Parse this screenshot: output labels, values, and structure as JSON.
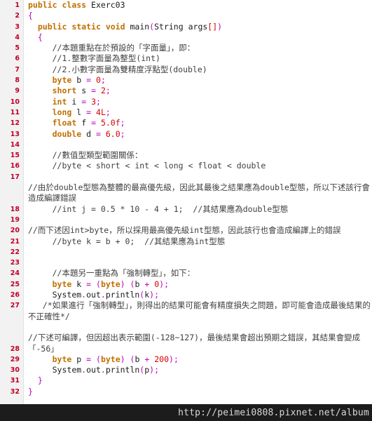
{
  "editor": {
    "language": "java",
    "class_name": "Exerc03",
    "colors": {
      "background": "#ffffff",
      "gutter_background": "#f2f2f2",
      "gutter_border": "#e2e2e2",
      "line_number": "#c00024",
      "keyword": "#c07000",
      "number_literal": "#d40000",
      "punctuation": "#c000c0",
      "comment": "#3f3f3f",
      "identifier": "#1a1a1a",
      "watermark_bar": "#1c1c1c",
      "watermark_text": "#d8d8d8"
    },
    "lines": [
      {
        "n": "1",
        "num_pos": "top",
        "text": "public class Exerc03"
      },
      {
        "n": "2",
        "num_pos": "top",
        "text": "{"
      },
      {
        "n": "3",
        "num_pos": "top",
        "text": "  public static void main(String args[])"
      },
      {
        "n": "4",
        "num_pos": "top",
        "text": "  {"
      },
      {
        "n": "5",
        "num_pos": "top",
        "text": "     //本題重點在於預設的「字面量」，即："
      },
      {
        "n": "6",
        "num_pos": "top",
        "text": "     //1.整數字面量為整型(int)"
      },
      {
        "n": "7",
        "num_pos": "top",
        "text": "     //2.小數字面量為雙精度浮點型(double)"
      },
      {
        "n": "8",
        "num_pos": "top",
        "text": "     byte b = 0;"
      },
      {
        "n": "9",
        "num_pos": "top",
        "text": "     short s = 2;"
      },
      {
        "n": "10",
        "num_pos": "top",
        "text": "     int i = 3;"
      },
      {
        "n": "11",
        "num_pos": "top",
        "text": "     long l = 4L;"
      },
      {
        "n": "12",
        "num_pos": "top",
        "text": "     float f = 5.0f;"
      },
      {
        "n": "13",
        "num_pos": "top",
        "text": "     double d = 6.0;"
      },
      {
        "n": "14",
        "num_pos": "top",
        "text": ""
      },
      {
        "n": "15",
        "num_pos": "top",
        "text": "     //數值型類型範圍關係："
      },
      {
        "n": "16",
        "num_pos": "top",
        "text": "     //byte < short < int < long < float < double"
      },
      {
        "n": "17",
        "num_pos": "top",
        "text": ""
      },
      {
        "n": "18",
        "num_pos": "bottom",
        "text": "//由於double型態為整體的最高優先級，因此其最後之結果應為double型態，所以下述該行會造成編譯錯誤\n     //int j = 0.5 * 10 - 4 + 1;  //其結果應為double型態"
      },
      {
        "n": "19",
        "num_pos": "top",
        "text": ""
      },
      {
        "n": "20",
        "num_pos": "top",
        "text": "//而下述因int>byte，所以採用最高優先級int型態，因此該行也會造成編譯上的錯誤"
      },
      {
        "n": "21",
        "num_pos": "top",
        "text": "     //byte k = b + 0;  //其結果應為int型態"
      },
      {
        "n": "22",
        "num_pos": "top",
        "text": ""
      },
      {
        "n": "23",
        "num_pos": "top",
        "text": ""
      },
      {
        "n": "24",
        "num_pos": "top",
        "text": "     //本題另一重點為「強制轉型」，如下："
      },
      {
        "n": "25",
        "num_pos": "top",
        "text": "     byte k = (byte) (b + 0);"
      },
      {
        "n": "26",
        "num_pos": "top",
        "text": "     System.out.println(k);"
      },
      {
        "n": "27",
        "num_pos": "top",
        "text": "   /*如果進行「強制轉型」，則得出的結果可能會有精度損失之問題，即可能會造成最後結果的不正確性*/"
      },
      {
        "n": "28",
        "num_pos": "bottom",
        "text": "\n//下述可編譯，但因超出表示範圍(-128~127)，最後結果會超出預期之錯誤，其結果會變成「-56」"
      },
      {
        "n": "29",
        "num_pos": "top",
        "text": "     byte p = (byte) (b + 200);"
      },
      {
        "n": "30",
        "num_pos": "top",
        "text": "     System.out.println(p);"
      },
      {
        "n": "31",
        "num_pos": "top",
        "text": "  }"
      },
      {
        "n": "32",
        "num_pos": "top",
        "text": "}"
      }
    ]
  },
  "watermark": {
    "url": "http://peimei0808.pixnet.net/album"
  }
}
